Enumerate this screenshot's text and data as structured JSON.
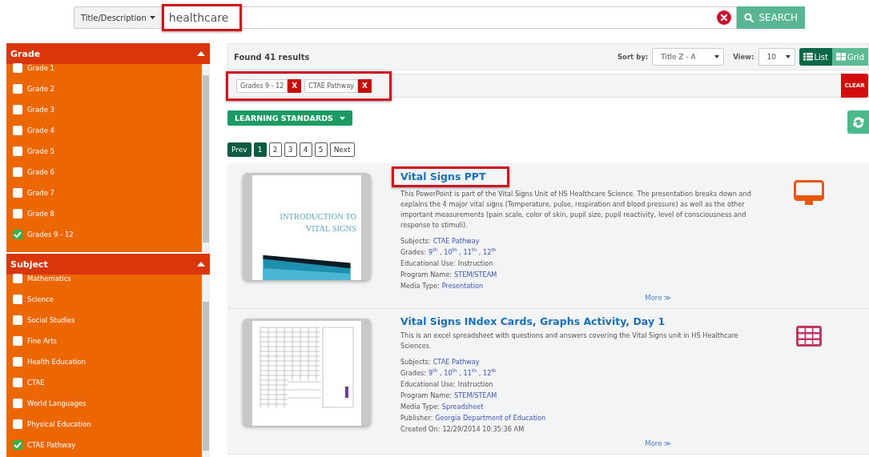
{
  "search": {
    "scope": "Title/Description",
    "value": "healthcare",
    "highlighted": true,
    "button": "SEARCH"
  },
  "filters": [
    {
      "title": "Grade",
      "expanded": true,
      "items": [
        {
          "label": "Grade 1",
          "checked": false
        },
        {
          "label": "Grade 2",
          "checked": false
        },
        {
          "label": "Grade 3",
          "checked": false
        },
        {
          "label": "Grade 4",
          "checked": false
        },
        {
          "label": "Grade 5",
          "checked": false
        },
        {
          "label": "Grade 6",
          "checked": false
        },
        {
          "label": "Grade 7",
          "checked": false
        },
        {
          "label": "Grade 8",
          "checked": false
        },
        {
          "label": "Grades 9 - 12",
          "checked": true
        }
      ]
    },
    {
      "title": "Subject",
      "expanded": true,
      "items": [
        {
          "label": "Mathematics",
          "checked": false
        },
        {
          "label": "Science",
          "checked": false
        },
        {
          "label": "Social Studies",
          "checked": false
        },
        {
          "label": "Fine Arts",
          "checked": false
        },
        {
          "label": "Health Education",
          "checked": false
        },
        {
          "label": "CTAE",
          "checked": false
        },
        {
          "label": "World Languages",
          "checked": false
        },
        {
          "label": "Physical Education",
          "checked": false
        },
        {
          "label": "CTAE Pathway",
          "checked": true
        }
      ]
    }
  ],
  "results_bar": {
    "count": "Found 41 results",
    "sort_label": "Sort by:",
    "sort_value": "Title Z - A",
    "view_label": "View:",
    "view_value": "10",
    "view_modes": [
      {
        "label": "List",
        "selected": true
      },
      {
        "label": "Grid",
        "selected": false
      }
    ]
  },
  "active_filters": {
    "highlighted": true,
    "tags": [
      {
        "label": "Grades 9 - 12",
        "remove": "X"
      },
      {
        "label": "CTAE Pathway",
        "remove": "X"
      }
    ],
    "clear": "CLEAR"
  },
  "standards_button": "LEARNING STANDARDS",
  "pagination": [
    {
      "label": "Prev",
      "kind": "nav"
    },
    {
      "label": "1",
      "kind": "page",
      "selected": true
    },
    {
      "label": "2",
      "kind": "page",
      "selected": false
    },
    {
      "label": "3",
      "kind": "page",
      "selected": false
    },
    {
      "label": "4",
      "kind": "page",
      "selected": false
    },
    {
      "label": "5",
      "kind": "page",
      "selected": false
    },
    {
      "label": "Next",
      "kind": "plain"
    }
  ],
  "results": [
    {
      "title": "Vital Signs PPT",
      "highlighted": true,
      "thumbnail": {
        "kind": "slide",
        "lines": [
          "INTRODUCTION TO",
          "VITAL SIGNS"
        ]
      },
      "kind": "presentation",
      "description": "This PowerPoint is part of the Vital Signs Unit of HS Healthcare Science. The presentation breaks down and explains the 4 major vital signs (Temperature, pulse, respiration and blood pressure) as well as the other important measurements (pain scale, color of skin, pupil size, pupil reactivity, level of consciousness and response to stimuli).",
      "meta": [
        {
          "label": "Subjects:",
          "value": "CTAE Pathway",
          "kind": "link"
        },
        {
          "label": "Grades:",
          "value": "9$^{th}$ , 10$^{th}$ , 11$^{th}$ , 12$^{th}$",
          "kind": "link"
        },
        {
          "label": "Educational Use:",
          "value": "Instruction",
          "kind": "text"
        },
        {
          "label": "Program Name:",
          "value": "STEM/STEAM",
          "kind": "link"
        },
        {
          "label": "Media Type:",
          "value": "Presentation",
          "kind": "link"
        }
      ],
      "more": "More ≫"
    },
    {
      "title": "Vital Signs INdex Cards, Graphs Activity, Day 1",
      "highlighted": false,
      "thumbnail": {
        "kind": "sheet"
      },
      "kind": "spreadsheet",
      "description": "This is an excel spreadsheet with questions and answers covering the Vital Signs unit in HS Healthcare Sciences.",
      "meta": [
        {
          "label": "Subjects:",
          "value": "CTAE Pathway",
          "kind": "link"
        },
        {
          "label": "Grades:",
          "value": "9$^{th}$ , 10$^{th}$ , 11$^{th}$ , 12$^{th}$",
          "kind": "link"
        },
        {
          "label": "Educational Use:",
          "value": "Instruction",
          "kind": "text"
        },
        {
          "label": "Program Name:",
          "value": "STEM/STEAM",
          "kind": "link"
        },
        {
          "label": "Media Type:",
          "value": "Spreadsheet",
          "kind": "link"
        },
        {
          "label": "Publisher:",
          "value": "Georgia Department of Education",
          "kind": "link"
        },
        {
          "label": "Created On:",
          "value": "12/29/2014 10:35:36 AM",
          "kind": "text"
        }
      ],
      "more": "More ≫"
    }
  ]
}
